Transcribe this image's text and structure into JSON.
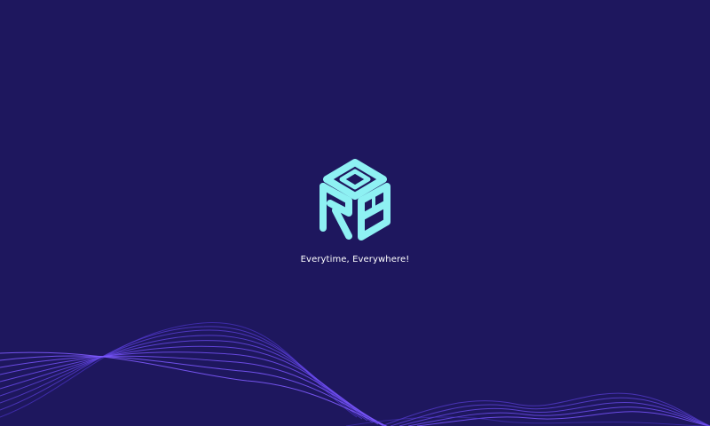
{
  "splash": {
    "brand_mark_text": "ORB",
    "tagline": "Everytime, Everywhere!",
    "logo_icon": "orb-cube-logo-icon"
  },
  "colors": {
    "background": "#1e175e",
    "logo": "#8ef1f3",
    "wave_primary": "#5a3ed8",
    "wave_secondary": "#6f48ff",
    "tagline": "#ffffff"
  }
}
